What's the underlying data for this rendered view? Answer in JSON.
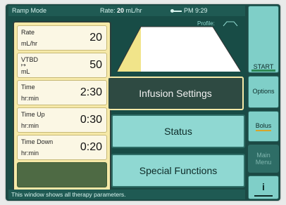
{
  "header": {
    "mode": "Ramp Mode",
    "rate_prefix": "Rate: ",
    "rate_value": "20",
    "rate_unit": " mL/hr",
    "time": "PM 9:29"
  },
  "profile": {
    "label": "Profile:"
  },
  "parameters": [
    {
      "label": "Rate",
      "unit": "mL/hr",
      "value": "20"
    },
    {
      "label": "VTBD",
      "unit": "mL",
      "value": "50"
    },
    {
      "label": "Time",
      "unit": "hr:min",
      "value": "2:30"
    },
    {
      "label": "Time Up",
      "unit": "hr:min",
      "value": "0:30"
    },
    {
      "label": "Time Down",
      "unit": "hr:min",
      "value": "0:20"
    }
  ],
  "menu": {
    "infusion_settings": "Infusion Settings",
    "status": "Status",
    "special_functions": "Special Functions"
  },
  "side": {
    "start": "START",
    "options": "Options",
    "bolus": "Bolus",
    "main_menu_line1": "Main",
    "main_menu_line2": "Menu",
    "info": "i"
  },
  "status_message": "This window shows all therapy parameters.",
  "colors": {
    "panel_yellow": "#f6e9a8",
    "teal_button": "#8fd8d2",
    "screen_bg": "#184c46",
    "graph_fill_left": "#f1e48a",
    "graph_fill_right": "#ffffff"
  }
}
